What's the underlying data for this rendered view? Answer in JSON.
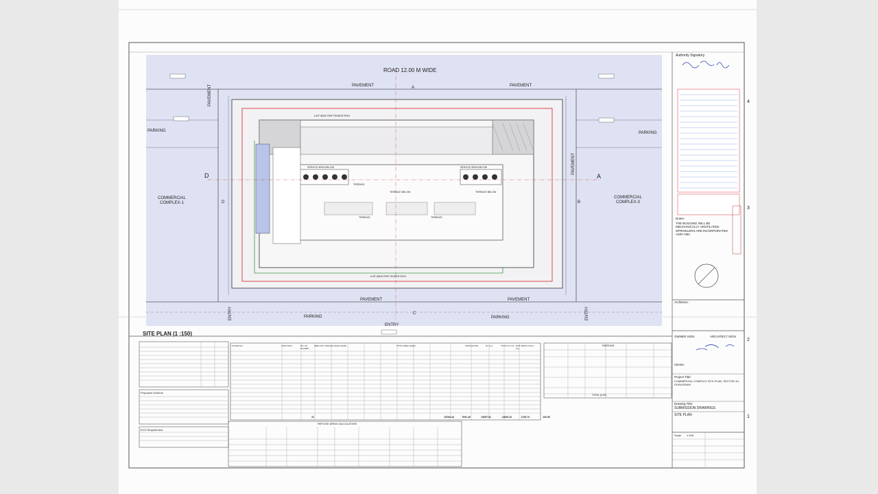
{
  "road": {
    "title": "ROAD 12.00 M WIDE",
    "pavement": "PAVEMENT",
    "parking": "PARKING",
    "entry": "ENTRY"
  },
  "site": {
    "left_complex": "COMMERCIAL COMPLEX-1",
    "right_complex": "COMMERCIAL COMPLEX-3"
  },
  "section_marks": {
    "a": "A",
    "b": "B",
    "c": "C",
    "d": "D"
  },
  "plan_labels": {
    "service_area": "SERVICE AREA BELOW",
    "terrace": "TERRACE",
    "terrace_below": "TERRACE BELOW",
    "tender_path": "6 MT WIDE FIRE TENDER PATH"
  },
  "title": "SITE PLAN (1 :150)",
  "notes": {
    "authority": "Authority Signatory",
    "notes_label": "Notes:",
    "note1": "THE BUILDING WILL BE MECHANICALLY VENTILATED.",
    "note2": "SPRINKLERS ARE INCORPORATED AS/R AMC",
    "architects": "Architects :"
  },
  "titleblock": {
    "owner_sign": "OWNER SIGN",
    "architect_sign": "ARCHITECT SIGN",
    "clients": "Clients:",
    "project_title": "Project Title:",
    "project_name": "COMMERCIAL COMPLEX SITE PLAN, SECTOR 43, GURUGRAM",
    "drawing_title": "Drawing Title:",
    "submission": "SUBMISSION DRAWINGS",
    "site_plan": "SITE PLAN",
    "scale_label": "Scale",
    "scale_value": "1:150"
  },
  "row_numbers": [
    "4",
    "3",
    "2",
    "1"
  ],
  "tables": {
    "main_header": [
      "FLOOR NO.",
      "FUNCTION",
      "NO. OF FLOORS",
      "AREA OF A SINGLE LEVEL (SQM)",
      "TOTAL AREA (SQM)",
      "POPULATION",
      "HT. (m)",
      "TOTAL HT (m)",
      "EXIT WIDTH CALC. (m)"
    ],
    "main_total": [
      "21",
      "15764.44",
      "7091.40",
      "23057.61",
      "11829.24",
      "1728.73",
      "102.90"
    ],
    "refuge_title": "REFUGE AREA CALCULATION",
    "proposed_scheme": "Proposed Scheme",
    "ecs_req": "ECS Requirement",
    "parking_title": "PARKING",
    "parking_total": "TOTAL (A+B)"
  },
  "colors": {
    "site_tint": "#dcdff2",
    "red_line": "#d9363e",
    "green_line": "#3f9b3f"
  }
}
